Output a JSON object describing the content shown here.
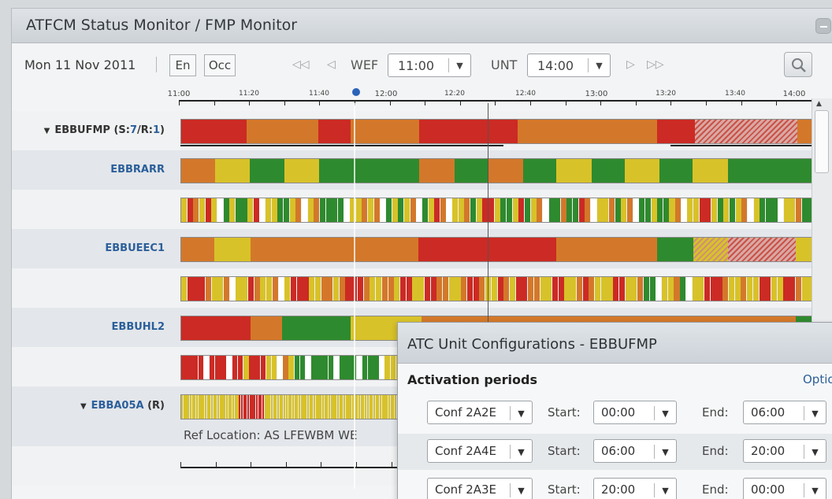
{
  "window": {
    "title": "ATFCM Status Monitor / FMP Monitor"
  },
  "toolbar": {
    "date": "Mon 11 Nov 2011",
    "en_label": "En",
    "occ_label": "Occ",
    "wef_label": "WEF",
    "wef_value": "11:00",
    "unt_label": "UNT",
    "unt_value": "14:00"
  },
  "timeline": {
    "ticks": [
      "11:00",
      "11:20",
      "11:40",
      "12:00",
      "12:20",
      "12:40",
      "13:00",
      "13:20",
      "13:40",
      "14:00"
    ]
  },
  "colors": {
    "red": "#cc2a24",
    "orange": "#d3782a",
    "yellow": "#d8c229",
    "green": "#2e8a2e",
    "grey": "#ffffff"
  },
  "rows": {
    "ebbufmp": {
      "label": "EBBUFMP",
      "suffix_open": " (S:",
      "s": "7",
      "mid": "/R:",
      "r": "1",
      "suffix_close": ")"
    },
    "ebbrarr": {
      "label": "EBBRARR"
    },
    "ebbueec1": {
      "label": "EBBUEEC1"
    },
    "ebbuhl2": {
      "label": "EBBUHL2"
    },
    "ebba05a": {
      "label": "EBBA05A",
      "suffix": " (R)"
    },
    "ref_location": "Ref Location:  AS LFEWBM     WE"
  },
  "dialog": {
    "title": "ATC Unit Configurations  -  EBBUFMP",
    "section": "Activation periods",
    "options": "Options",
    "start_label": "Start:",
    "end_label": "End:",
    "configs": [
      {
        "name": "Conf 2A2E",
        "start": "00:00",
        "end": "06:00"
      },
      {
        "name": "Conf 2A4E",
        "start": "06:00",
        "end": "20:00"
      },
      {
        "name": "Conf 2A3E",
        "start": "20:00",
        "end": "00:00"
      }
    ]
  }
}
